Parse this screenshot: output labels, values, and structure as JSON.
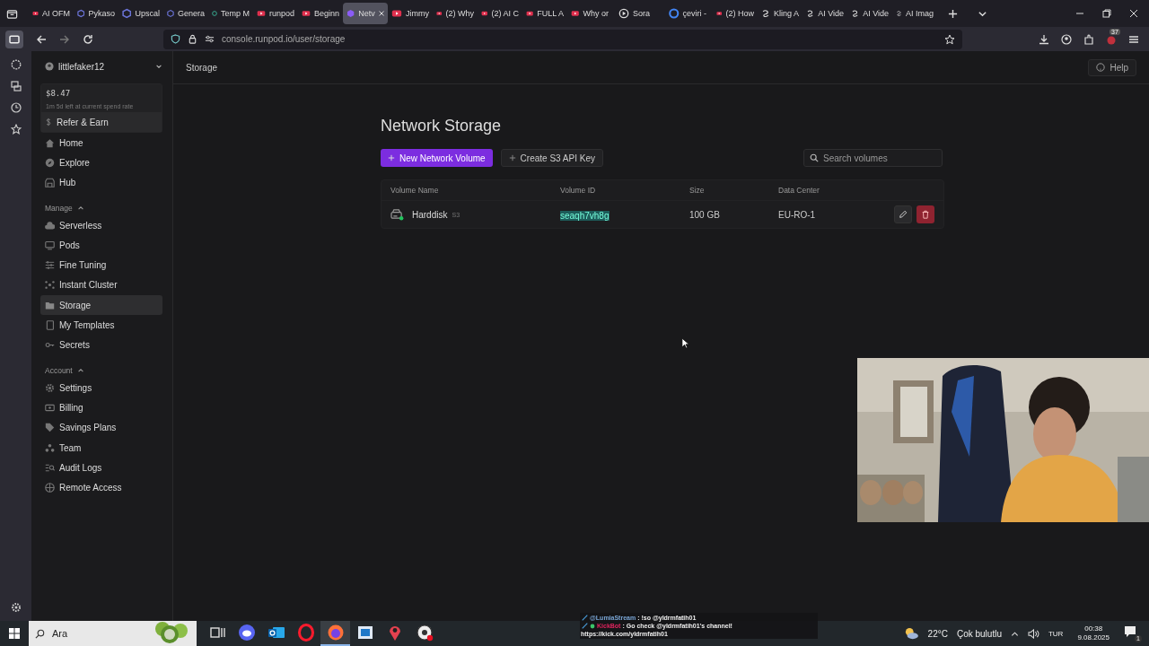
{
  "browser": {
    "tabs": [
      {
        "label": "AI OFM",
        "kind": "video",
        "selected": false
      },
      {
        "label": "Pykaso",
        "kind": "hex",
        "selected": false
      },
      {
        "label": "Upscal",
        "kind": "hex",
        "selected": false
      },
      {
        "label": "Genera",
        "kind": "hex",
        "selected": false
      },
      {
        "label": "Temp M",
        "kind": "ring",
        "selected": false
      },
      {
        "label": "runpod",
        "kind": "video",
        "selected": false
      },
      {
        "label": "Beginn",
        "kind": "video",
        "selected": false
      },
      {
        "label": "Netv",
        "kind": "cube",
        "selected": true
      },
      {
        "label": "Jimmy",
        "kind": "video",
        "selected": false
      },
      {
        "label": "(2) Why",
        "kind": "video",
        "selected": false
      },
      {
        "label": "(2) AI C",
        "kind": "video",
        "selected": false
      },
      {
        "label": "FULL A",
        "kind": "video",
        "selected": false
      },
      {
        "label": "Why or",
        "kind": "video",
        "selected": false
      },
      {
        "label": "Sora",
        "kind": "play",
        "selected": false
      },
      {
        "label": "çeviri -",
        "kind": "g",
        "selected": false
      },
      {
        "label": "(2) How",
        "kind": "video",
        "selected": false
      },
      {
        "label": "Kling A",
        "kind": "knot",
        "selected": false
      },
      {
        "label": "AI Vide",
        "kind": "knot",
        "selected": false
      },
      {
        "label": "AI Vide",
        "kind": "knot",
        "selected": false
      },
      {
        "label": "AI Imag",
        "kind": "knot",
        "selected": false
      }
    ],
    "url": "console.runpod.io/user/storage",
    "extension_badge": "37"
  },
  "account": {
    "name": "littlefaker12",
    "balance": "$8.47",
    "spend_note": "1m 5d left at current spend rate",
    "refer": "Refer & Earn"
  },
  "nav": [
    {
      "label": "Home",
      "kind": "home",
      "selected": false
    },
    {
      "label": "Explore",
      "kind": "compass",
      "selected": false
    },
    {
      "label": "Hub",
      "kind": "store",
      "selected": false
    }
  ],
  "groups": [
    {
      "title": "Manage",
      "expanded": true,
      "items": [
        {
          "label": "Serverless",
          "kind": "cloud",
          "selected": false
        },
        {
          "label": "Pods",
          "kind": "monitor",
          "selected": false
        },
        {
          "label": "Fine Tuning",
          "kind": "sliders",
          "selected": false
        },
        {
          "label": "Instant Cluster",
          "kind": "cluster",
          "selected": false
        },
        {
          "label": "Storage",
          "kind": "folder",
          "selected": true
        },
        {
          "label": "My Templates",
          "kind": "doc",
          "selected": false
        },
        {
          "label": "Secrets",
          "kind": "key",
          "selected": false
        }
      ]
    },
    {
      "title": "Account",
      "expanded": true,
      "items": [
        {
          "label": "Settings",
          "kind": "gear",
          "selected": false
        },
        {
          "label": "Billing",
          "kind": "bill",
          "selected": false
        },
        {
          "label": "Savings Plans",
          "kind": "tag",
          "selected": false
        },
        {
          "label": "Team",
          "kind": "team",
          "selected": false
        },
        {
          "label": "Audit Logs",
          "kind": "logs",
          "selected": false
        },
        {
          "label": "Remote Access",
          "kind": "globe",
          "selected": false
        }
      ]
    }
  ],
  "header": {
    "breadcrumb": "Storage",
    "help": "Help"
  },
  "page": {
    "title": "Network Storage",
    "primary_button": "New Network Volume",
    "secondary_button": "Create S3 API Key",
    "search": {
      "placeholder": "Search volumes"
    },
    "columns": [
      "Volume Name",
      "Volume ID",
      "Size",
      "Data Center"
    ],
    "rows": [
      {
        "name": "Harddisk",
        "tag": "S3",
        "id": "seaqh7vh8g",
        "id_selected": true,
        "size": "100 GB",
        "data_center": "EU-RO-1",
        "color": "#22c55e"
      }
    ]
  },
  "chat": [
    {
      "user": "@LumiaStream",
      "color": "#7aa6d6",
      "message": ": !so @yldrmfatih01"
    },
    {
      "user": "KickBot",
      "color": "#e0245e",
      "message": ": Go check @yldrmfatih01's channel!"
    }
  ],
  "chat_link": "https://kick.com/yldrmfatih01",
  "taskbar": {
    "search": "Ara",
    "apps": [
      {
        "kind": "taskview",
        "selected": false
      },
      {
        "kind": "discord",
        "selected": false
      },
      {
        "kind": "outlook",
        "selected": false
      },
      {
        "kind": "opera",
        "selected": false
      },
      {
        "kind": "firefox",
        "selected": true
      },
      {
        "kind": "window",
        "selected": false
      },
      {
        "kind": "pin",
        "selected": false
      },
      {
        "kind": "obs",
        "selected": false
      }
    ],
    "temperature": "22°C",
    "weather": "Çok bulutlu",
    "language": "TUR",
    "time": "00:38",
    "date": "9.08.2025",
    "notifications": "1"
  }
}
